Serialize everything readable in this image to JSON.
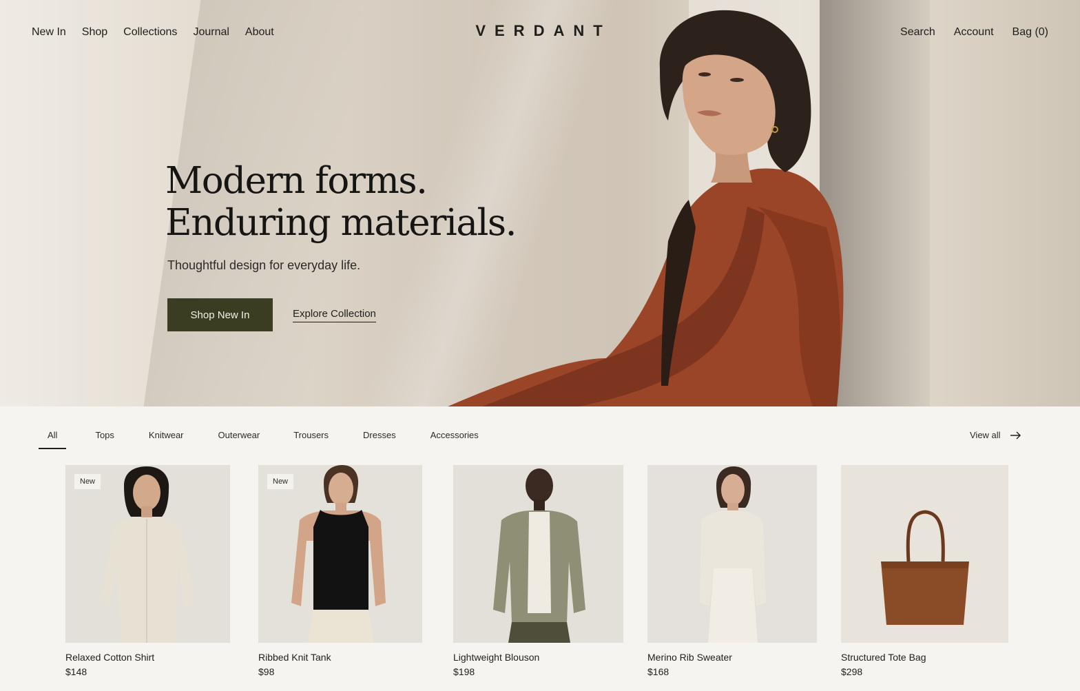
{
  "brand": "VERDANT",
  "nav": {
    "left": [
      "New In",
      "Shop",
      "Collections",
      "Journal",
      "About"
    ],
    "search": "Search",
    "account": "Account",
    "bag": "Bag (0)"
  },
  "hero": {
    "headline_line1": "Modern forms.",
    "headline_line2": "Enduring materials.",
    "subline": "Thoughtful design for everyday life.",
    "primary_cta": "Shop New In",
    "secondary_cta": "Explore Collection"
  },
  "filters": {
    "tabs": [
      "All",
      "Tops",
      "Knitwear",
      "Outerwear",
      "Trousers",
      "Dresses",
      "Accessories"
    ],
    "active": "All",
    "view_all": "View all"
  },
  "products": [
    {
      "name": "Relaxed Cotton Shirt",
      "price": "$148",
      "badge": "New"
    },
    {
      "name": "Ribbed Knit Tank",
      "price": "$98",
      "badge": "New"
    },
    {
      "name": "Lightweight Blouson",
      "price": "$198",
      "badge": ""
    },
    {
      "name": "Merino Rib Sweater",
      "price": "$168",
      "badge": ""
    },
    {
      "name": "Structured Tote Bag",
      "price": "$298",
      "badge": ""
    }
  ],
  "colors": {
    "primary_button": "#3b3d22",
    "background": "#f6f4f0",
    "text": "#1e1e1a",
    "coat": "#9a4428"
  }
}
